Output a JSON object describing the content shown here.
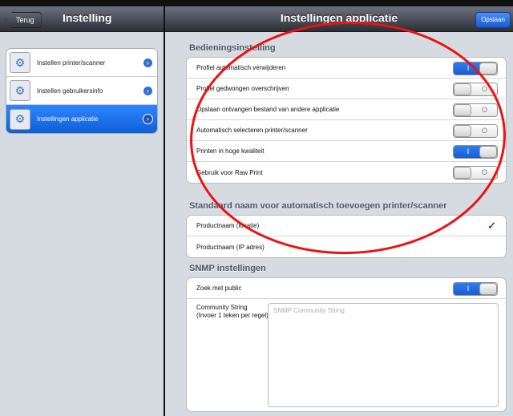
{
  "left_nav": {
    "back_label": "Terug",
    "title": "Instelling"
  },
  "left_list": [
    {
      "label": "Instellen printer/scanner",
      "icon": "printer-gear-icon",
      "selected": false
    },
    {
      "label": "Instellen gebruikersinfo",
      "icon": "user-gear-icon",
      "selected": false
    },
    {
      "label": "Instellingen applicatie",
      "icon": "app-settings-icon",
      "selected": true
    }
  ],
  "right_nav": {
    "title": "Instellingen applicatie",
    "save_label": "Opslaan"
  },
  "sections": {
    "operation": {
      "title": "Bedieningsinstelling",
      "rows": [
        {
          "label": "Profiel automatisch verwijderen",
          "on": true
        },
        {
          "label": "Profiel gedwongen overschrijven",
          "on": false
        },
        {
          "label": "Opslaan ontvangen bestand van andere applicatie",
          "on": false
        },
        {
          "label": "Automatisch selecteren printer/scanner",
          "on": false
        },
        {
          "label": "Printen in hoge kwaliteit",
          "on": true
        },
        {
          "label": "Gebruik voor Raw Print",
          "on": false
        }
      ]
    },
    "default_name": {
      "title": "Standaard naam voor automatisch toevoegen printer/scanner",
      "options": [
        {
          "label": "Productnaam (locatie)",
          "checked": true
        },
        {
          "label": "Productnaam (IP adres)",
          "checked": false
        }
      ]
    },
    "snmp": {
      "title": "SNMP instellingen",
      "search_public_label": "Zoek met public",
      "search_public_on": true,
      "community_label": "Community String (Invoer 1 teken per regel)",
      "community_placeholder": "SNMP Community String",
      "community_value": ""
    }
  },
  "switch_on_text": "I",
  "switch_off_text": "O",
  "checkmark": "✓",
  "colors": {
    "accent_blue": "#1a5cd0",
    "annotation_red": "#ee1111"
  }
}
